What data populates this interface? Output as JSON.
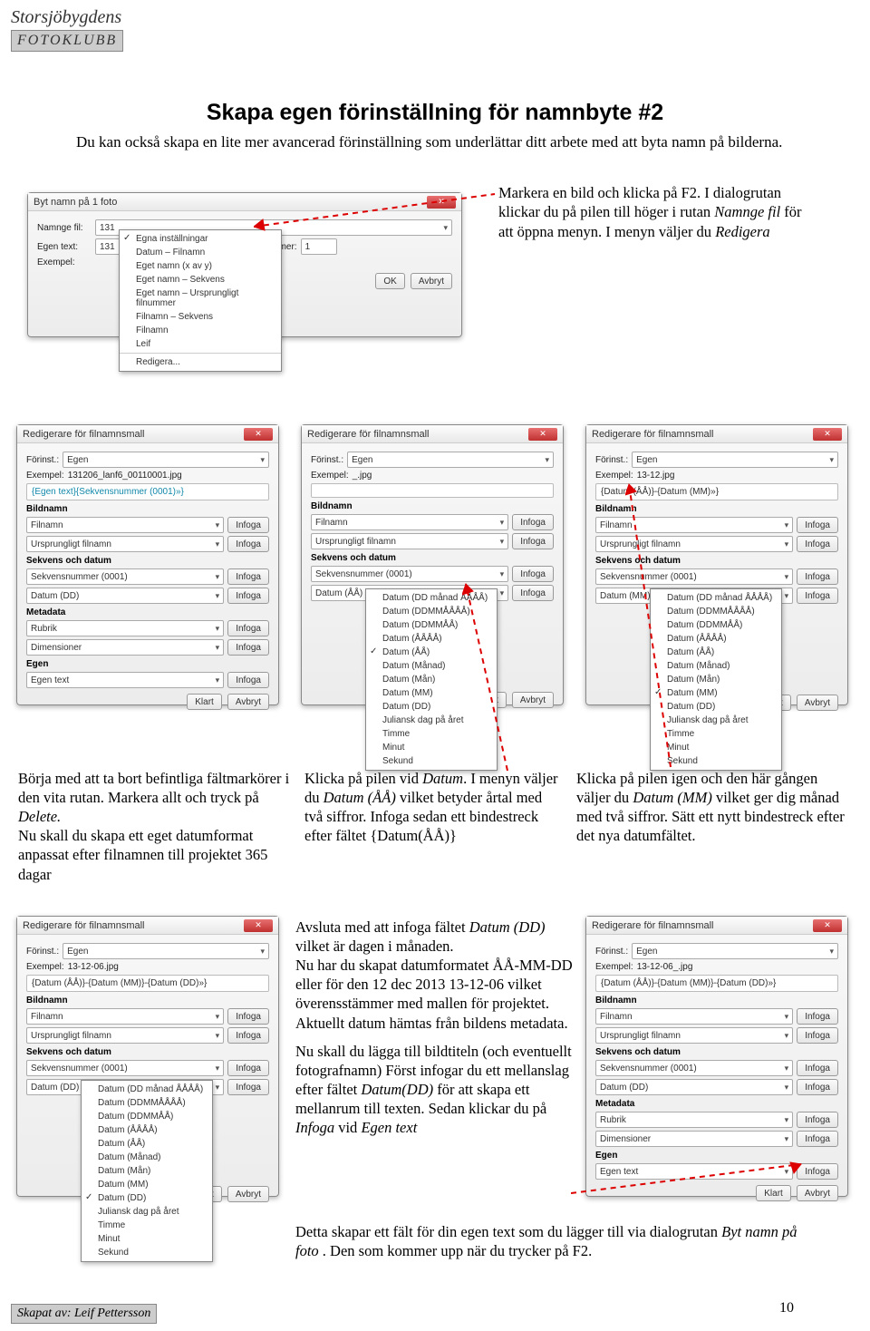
{
  "logo": {
    "line1": "Storsjöbygdens",
    "line2": "FOTOKLUBB"
  },
  "title": "Skapa egen förinställning för namnbyte #2",
  "intro": "Du kan också skapa en lite mer avancerad förinställning som underlättar ditt arbete med att byta namn på bilderna.",
  "right_caption": {
    "p1": "Markera en bild och klicka på F2. I dialogrutan klickar du på pilen till höger i rutan ",
    "i1": "Namnge fil",
    "p2": " för att öppna menyn. I menyn väljer du ",
    "i2": "Redigera"
  },
  "rename_dialog": {
    "title": "Byt namn på 1 foto",
    "lblNamnge": "Namnge fil:",
    "valNamnge": "131",
    "lblEgen": "Egen text:",
    "valEgen": "131",
    "lblStart": "Startnummer:",
    "valStart": "1",
    "lblExempel": "Exempel:",
    "btnOK": "OK",
    "btnAvbryt": "Avbryt",
    "menu": [
      "Egna inställningar",
      "Datum – Filnamn",
      "Eget namn (x av y)",
      "Eget namn – Sekvens",
      "Eget namn – Ursprungligt filnummer",
      "Filnamn – Sekvens",
      "Filnamn",
      "Leif",
      "Redigera..."
    ],
    "menuChecked": 0
  },
  "editor": {
    "title": "Redigerare för filnamnsmall",
    "lblForinst": "Förinst.:",
    "valForinst": "Egen",
    "lblExempel": "Exempel:",
    "secBildnamn": "Bildnamn",
    "opt1": "Filnamn",
    "opt2": "Ursprungligt filnamn",
    "secSekvens": "Sekvens och datum",
    "opt3": "Sekvensnummer (0001)",
    "secMetadata": "Metadata",
    "opt5": "Rubrik",
    "opt6": "Dimensioner",
    "secEgen": "Egen",
    "opt7": "Egen text",
    "btnInfoga": "Infoga",
    "btnKlart": "Klart",
    "btnAvbryt": "Avbryt",
    "ex1": "131206_lanf6_00110001.jpg",
    "patt1": "{Egen text}{Sekvensnummer (0001)»}",
    "ex2": "_.jpg",
    "patt2": "",
    "ex3": "13-12.jpg",
    "patt3": "{Datum (ÅÅ)}-{Datum (MM)»}",
    "ex4": "13-12-06.jpg",
    "patt4": "{Datum (ÅÅ)}-{Datum (MM)}-{Datum (DD)»}",
    "ex5": "13-12-06_.jpg",
    "patt5": "{Datum (ÅÅ)}-{Datum (MM)}-{Datum (DD)»}"
  },
  "date_menu": {
    "opt": [
      "Datum (ÅÅ)",
      "Datum (MM)",
      "Datum (DD)"
    ],
    "items": [
      "Datum (DD månad ÅÅÅÅ)",
      "Datum (DDMMÅÅÅÅ)",
      "Datum (DDMMÅÅ)",
      "Datum (ÅÅÅÅ)",
      "Datum (ÅÅ)",
      "Datum (Månad)",
      "Datum (Mån)",
      "Datum (MM)",
      "Datum (DD)",
      "Juliansk dag på året",
      "Timme",
      "Minut",
      "Sekund"
    ]
  },
  "col1": "Börja med att ta bort befintliga fältmarkörer i den vita rutan. Markera allt och tryck på ",
  "col1_i": "Delete.",
  "col1b": "Nu skall du skapa ett eget  datumformat anpassat efter  filnamnen till projektet 365 dagar",
  "col2": "Klicka på pilen vid ",
  "col2_i1": "Datum",
  "col2b": ". I menyn väljer du ",
  "col2_i2": "Datum (ÅÅ)",
  "col2c": " vilket betyder årtal med två siffror. Infoga sedan ett bindestreck efter fältet {Datum(ÅÅ)}",
  "col3": "Klicka på pilen igen och den här gången väljer du ",
  "col3_i": "Datum (MM)",
  "col3b": " vilket ger dig månad med två siffror. Sätt ett nytt bindestreck efter det nya datumfältet.",
  "para_b1": "Avsluta med att infoga fältet ",
  "para_b1i": "Datum (DD)",
  "para_b1b": " vilket är dagen i månaden.",
  "para_b2": "Nu har du skapat datumformatet ÅÅ-MM-DD eller för den 12 dec 2013  13-12-06 vilket överensstämmer med mallen för projektet. Aktuellt datum hämtas från bildens metadata.",
  "para_b3a": "Nu skall du lägga till bildtiteln (och eventuellt fotografnamn) Först infogar du ett mellanslag efter  fältet ",
  "para_b3i1": "Datum(DD)",
  "para_b3b": " för att skapa ett mellanrum till texten.  Sedan klickar du på ",
  "para_b3i2": "Infoga",
  "para_b3c": " vid ",
  "para_b3i3": "Egen text",
  "para_b4a": "Detta skapar ett fält för din egen text som du lägger till via dialogrutan ",
  "para_b4i": "Byt namn på foto",
  "para_b4b": " . Den som kommer upp när du trycker på F2.",
  "page": "10",
  "footer": "Skapat av: Leif Pettersson"
}
